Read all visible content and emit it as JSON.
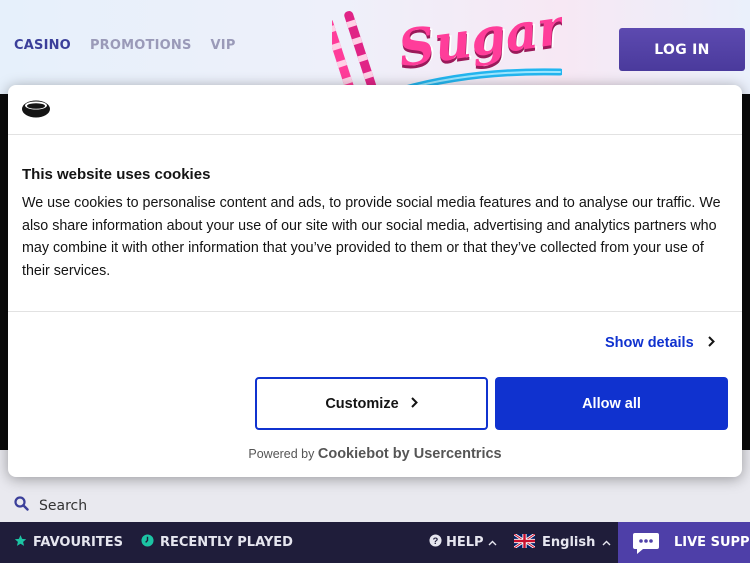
{
  "nav": {
    "items": [
      "CASINO",
      "PROMOTIONS",
      "VIP"
    ]
  },
  "header": {
    "logo_text": "Sugar",
    "login_label": "LOG IN"
  },
  "cookie": {
    "title": "This website uses cookies",
    "text": "We use cookies to personalise content and ads, to provide social media features and to analyse our traffic. We also share information about your use of our site with our social media, advertising and analytics partners who may combine it with other information that you’ve provided to them or that they’ve collected from your use of their services.",
    "show_details": "Show details",
    "customize": "Customize",
    "allow_all": "Allow all",
    "powered_label": "Powered by",
    "powered_brand": "Cookiebot by Usercentrics"
  },
  "search": {
    "label": "Search"
  },
  "bottom_bar": {
    "favourites": "FAVOURITES",
    "recently_played": "RECENTLY PLAYED",
    "help": "HELP",
    "language": "English",
    "live_support": "LIVE SUPPORT"
  },
  "colors": {
    "accent": "#4e3fa8",
    "cookie_blue": "#1032cf",
    "bar_bg": "#1f1d3a",
    "favourite_star": "#1cc4a4"
  }
}
